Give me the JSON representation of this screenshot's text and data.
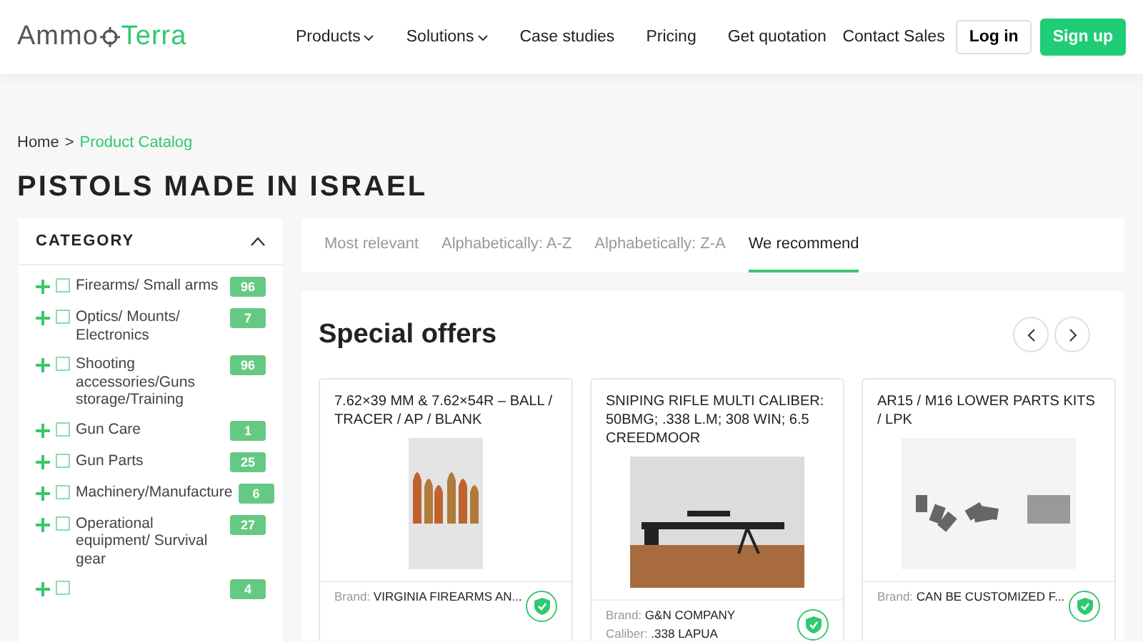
{
  "header": {
    "logo": {
      "left": "Ammo",
      "right": "Terra"
    },
    "nav": [
      {
        "label": "Products",
        "dropdown": true
      },
      {
        "label": "Solutions",
        "dropdown": true
      },
      {
        "label": "Case studies",
        "dropdown": false
      },
      {
        "label": "Pricing",
        "dropdown": false
      },
      {
        "label": "Get quotation",
        "dropdown": false
      }
    ],
    "contact": "Contact Sales",
    "login": "Log in",
    "signup": "Sign up"
  },
  "breadcrumb": [
    {
      "label": "Home",
      "current": false
    },
    {
      "label": "Product Catalog",
      "current": true
    }
  ],
  "breadcrumb_separator": ">",
  "page_title": "PISTOLS MADE IN ISRAEL",
  "sidebar": {
    "title": "CATEGORY",
    "expanded": true,
    "items": [
      {
        "label": "Firearms/ Small arms",
        "count": "96",
        "checked": false
      },
      {
        "label": "Optics/ Mounts/ Electronics",
        "count": "7",
        "checked": false
      },
      {
        "label": "Shooting accessories/Guns storage/Training",
        "count": "96",
        "checked": false
      },
      {
        "label": "Gun Care",
        "count": "1",
        "checked": false
      },
      {
        "label": "Gun Parts",
        "count": "25",
        "checked": false
      },
      {
        "label": "Machinery/Manufacture",
        "count": "6",
        "checked": false
      },
      {
        "label": "Operational equipment/ Survival gear",
        "count": "27",
        "checked": false
      },
      {
        "count": "4",
        "checked": false
      }
    ]
  },
  "sort_tabs": [
    {
      "label": "Most relevant",
      "selected": false
    },
    {
      "label": "Alphabetically: A-Z",
      "selected": false
    },
    {
      "label": "Alphabetically: Z-A",
      "selected": false
    },
    {
      "label": "We recommend",
      "selected": true
    }
  ],
  "offers": {
    "title": "Special offers",
    "products": [
      {
        "title": "7.62×39 MM & 7.62×54R – BALL / TRACER / AP / BLANK",
        "kind": "ammo",
        "fields": [
          {
            "label": "Brand:",
            "value": "VIRGINIA FIREARMS AN..."
          }
        ],
        "verified": true
      },
      {
        "title": "SNIPING RIFLE MULTI CALIBER: 50BMG; .338 L.M; 308 WIN; 6.5 CREEDMOOR",
        "kind": "rifle",
        "fields": [
          {
            "label": "Brand:",
            "value": "G&N COMPANY"
          },
          {
            "label": "Caliber:",
            "value": ".338 LAPUA"
          }
        ],
        "verified": true
      },
      {
        "title": "AR15 / M16 LOWER PARTS KITS / LPK",
        "kind": "parts",
        "fields": [
          {
            "label": "Brand:",
            "value": "CAN BE CUSTOMIZED F..."
          }
        ],
        "verified": true
      }
    ]
  }
}
